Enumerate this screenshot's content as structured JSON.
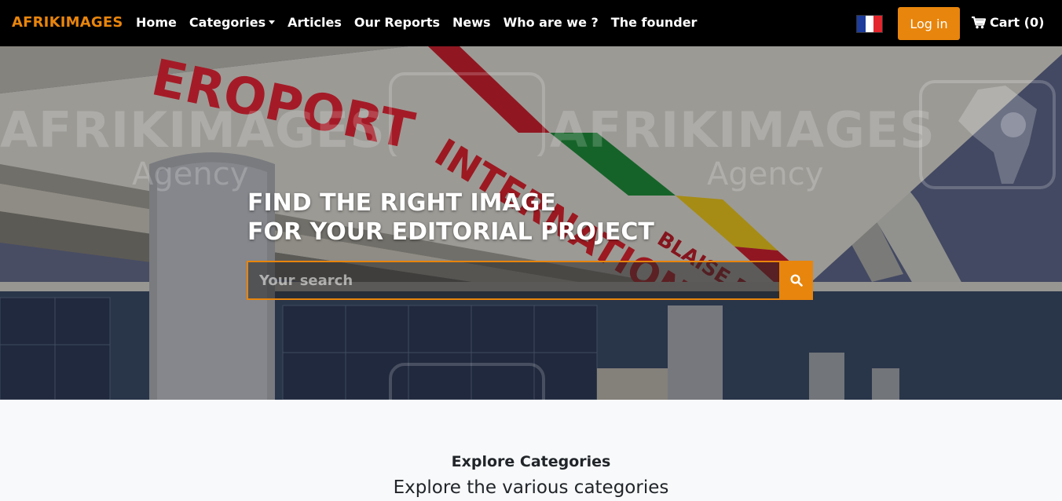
{
  "brand": {
    "name": "AFRIKIMAGES",
    "color": "#e8850c"
  },
  "nav": {
    "items": [
      {
        "label": "Home"
      },
      {
        "label": "Categories",
        "dropdown": true
      },
      {
        "label": "Articles"
      },
      {
        "label": "Our Reports"
      },
      {
        "label": "News"
      },
      {
        "label": "Who are we ?"
      },
      {
        "label": "The founder"
      }
    ],
    "language_icon": "france-flag-icon",
    "login_label": "Log in",
    "cart_icon": "cart-icon",
    "cart_label": "Cart (0)"
  },
  "hero": {
    "title_line1": "FIND THE RIGHT IMAGE",
    "title_line2": "FOR YOUR EDITORIAL PROJECT",
    "search_placeholder": "Your search",
    "search_icon": "search-icon",
    "background_sign": "AEROPORT INTERNATIONAL BLAISE DIAGNE",
    "watermark": "AFRIKIMAGES",
    "watermark_sub": "Agency"
  },
  "explore": {
    "title": "Explore Categories",
    "subtitle": "Explore the various categories"
  },
  "colors": {
    "accent": "#e8850c",
    "navbar": "#000000",
    "page_bg": "#f8f9fa"
  }
}
